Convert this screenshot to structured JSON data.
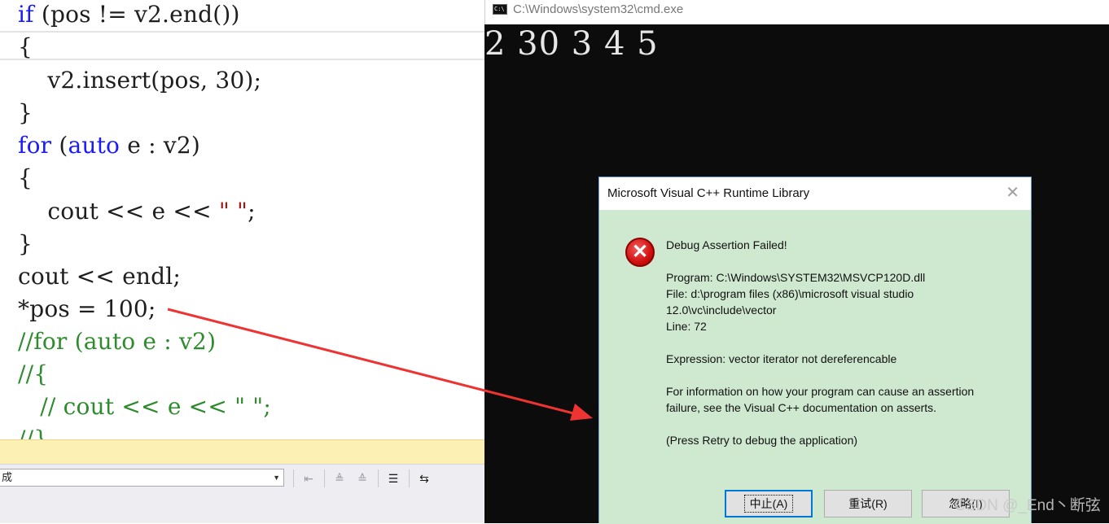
{
  "editor": {
    "code_lines": [
      {
        "tokens": [
          {
            "t": "if",
            "c": "kw"
          },
          {
            "t": " (pos != v2.end())",
            "c": "tok"
          }
        ]
      },
      {
        "tokens": [
          {
            "t": "{",
            "c": "tok"
          }
        ]
      },
      {
        "tokens": [
          {
            "t": "    v2.insert(pos, 30);",
            "c": "tok"
          }
        ]
      },
      {
        "tokens": [
          {
            "t": "}",
            "c": "tok"
          }
        ]
      },
      {
        "tokens": [
          {
            "t": "for",
            "c": "kw"
          },
          {
            "t": " (",
            "c": "tok"
          },
          {
            "t": "auto",
            "c": "kw"
          },
          {
            "t": " e : v2)",
            "c": "tok"
          }
        ]
      },
      {
        "tokens": [
          {
            "t": "{",
            "c": "tok"
          }
        ]
      },
      {
        "tokens": [
          {
            "t": "    cout << e << ",
            "c": "tok"
          },
          {
            "t": "\" \"",
            "c": "str"
          },
          {
            "t": ";",
            "c": "tok"
          }
        ]
      },
      {
        "tokens": [
          {
            "t": "}",
            "c": "tok"
          }
        ]
      },
      {
        "tokens": [
          {
            "t": "cout << endl;",
            "c": "tok"
          }
        ]
      },
      {
        "tokens": [
          {
            "t": "*pos = 100;",
            "c": "tok"
          }
        ]
      },
      {
        "tokens": [
          {
            "t": "//for (auto e : v2)",
            "c": "cm"
          }
        ]
      },
      {
        "tokens": [
          {
            "t": "//{",
            "c": "cm"
          }
        ]
      },
      {
        "tokens": [
          {
            "t": "   // cout << e << \" \";",
            "c": "cm"
          }
        ]
      },
      {
        "tokens": [
          {
            "t": "//}",
            "c": "cm"
          }
        ]
      }
    ],
    "output_source_value": "成"
  },
  "console": {
    "title": "C:\\Windows\\system32\\cmd.exe",
    "icon_text": "C:\\",
    "output": "2 30 3 4 5"
  },
  "dialog": {
    "title": "Microsoft Visual C++ Runtime Library",
    "close_glyph": "✕",
    "heading": "Debug Assertion Failed!",
    "program": "Program: C:\\Windows\\SYSTEM32\\MSVCP120D.dll",
    "file_line1": "File: d:\\program files (x86)\\microsoft visual studio",
    "file_line2": "12.0\\vc\\include\\vector",
    "line": "Line: 72",
    "expression": "Expression: vector iterator not dereferencable",
    "info_line1": "For information on how your program can cause an assertion",
    "info_line2": "failure, see the Visual C++ documentation on asserts.",
    "press_retry": "(Press Retry to debug the application)",
    "buttons": {
      "abort": "中止(A)",
      "retry": "重试(R)",
      "ignore": "忽略(I)"
    }
  },
  "watermark": "CSDN @_End丶断弦",
  "colors": {
    "keyword": "#1a1aff",
    "comment": "#2e8b2e",
    "annotation_arrow": "#ee3333",
    "dialog_body": "#cfe8d0"
  },
  "icons": [
    "error-icon",
    "console-icon",
    "close-icon",
    "annotation-arrow-icon"
  ]
}
